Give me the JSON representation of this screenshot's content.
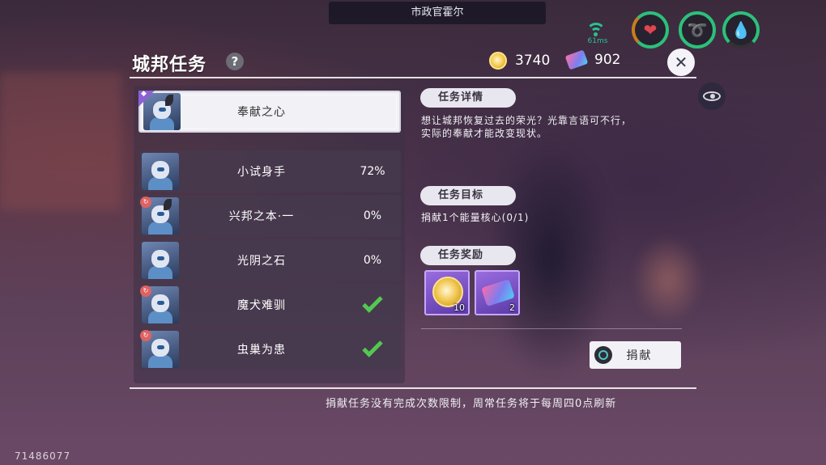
{
  "npc_name": "市政官霍尔",
  "status": {
    "ping": "61ms",
    "icons": [
      "signal-icon",
      "heart-icon",
      "stamina-icon",
      "water-icon"
    ],
    "colors": {
      "ring": "#2cc07a",
      "heart": "#e0464f",
      "stamina": "#e3b32e",
      "water": "#2bb1c9"
    }
  },
  "header": {
    "title": "城邦任务",
    "help_label": "?",
    "gold": "3740",
    "tickets": "902",
    "close_label": "✕"
  },
  "tasks": [
    {
      "name": "奉献之心",
      "progress": "",
      "status": "selected",
      "badge": "purple"
    },
    {
      "name": "小试身手",
      "progress": "72%",
      "status": "in-progress",
      "badge": ""
    },
    {
      "name": "兴邦之本·一",
      "progress": "0%",
      "status": "in-progress",
      "badge": "red"
    },
    {
      "name": "光阴之石",
      "progress": "0%",
      "status": "in-progress",
      "badge": ""
    },
    {
      "name": "魔犬难驯",
      "progress": "",
      "status": "completed",
      "badge": "red"
    },
    {
      "name": "虫巢为患",
      "progress": "",
      "status": "completed",
      "badge": "red"
    }
  ],
  "detail": {
    "desc_tag": "任务详情",
    "desc_line1": "想让城邦恢复过去的荣光？光靠言语可不行，",
    "desc_line2": "实际的奉献才能改变现状。",
    "goal_tag": "任务目标",
    "goal_text": "捐献1个能量核心(0/1)",
    "reward_tag": "任务奖励",
    "rewards": [
      {
        "icon": "gold-coin-icon",
        "count": "10"
      },
      {
        "icon": "ticket-icon",
        "count": "2"
      }
    ],
    "donate_label": "捐献"
  },
  "footer_note": "捐献任务没有完成次数限制，周常任务将于每周四0点刷新",
  "uid": "71486077"
}
